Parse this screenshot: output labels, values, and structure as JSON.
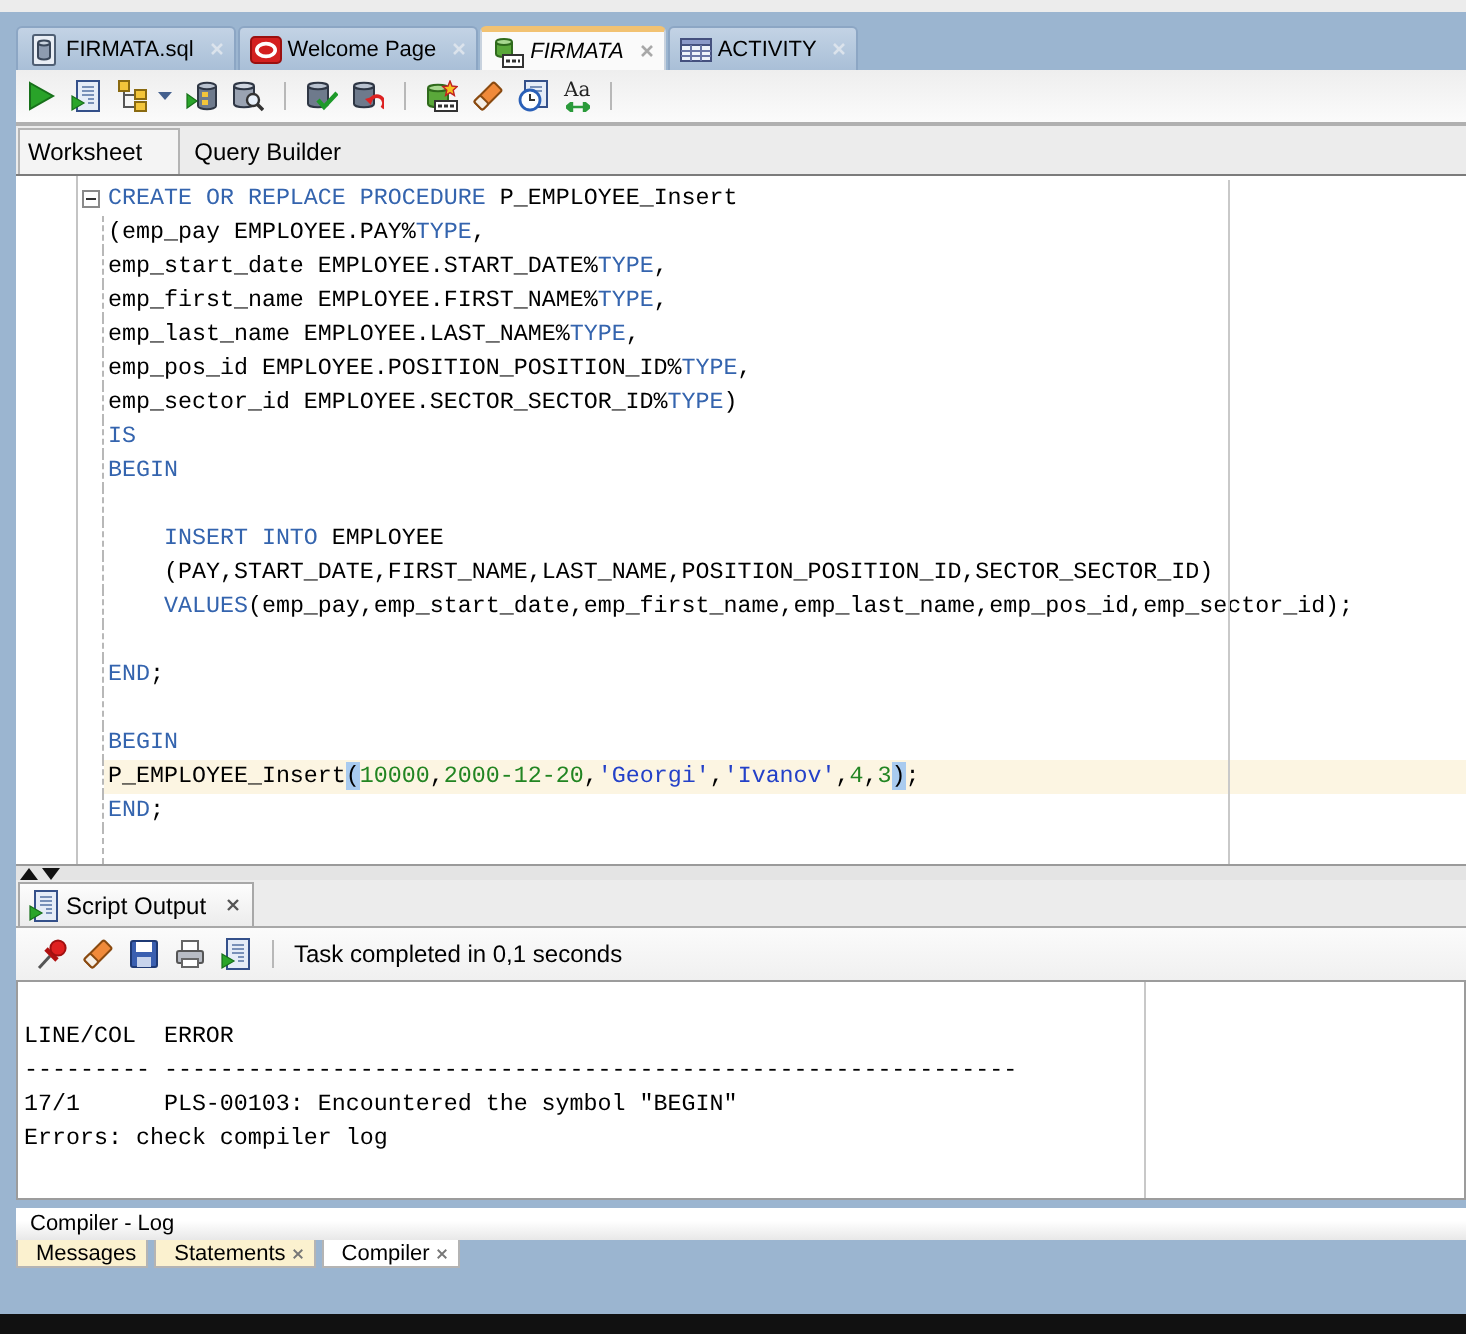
{
  "document_tabs": [
    {
      "label": "FIRMATA.sql",
      "kind": "sql-file",
      "selected": false
    },
    {
      "label": "Welcome Page",
      "kind": "start-page",
      "selected": false
    },
    {
      "label": "FIRMATA",
      "kind": "worksheet",
      "selected": true
    },
    {
      "label": "ACTIVITY",
      "kind": "table",
      "selected": false
    }
  ],
  "editor_toolbar": {
    "case_button_label": "Aa"
  },
  "editor_tabs": [
    {
      "label": "Worksheet",
      "selected": true
    },
    {
      "label": "Query Builder",
      "selected": false
    }
  ],
  "editor": {
    "lines": [
      {
        "kind": "fold-start",
        "current": false,
        "tokens": [
          {
            "kind": "keyword",
            "text": "CREATE OR REPLACE PROCEDURE"
          },
          {
            "kind": "plain",
            "text": " P_EMPLOYEE_Insert"
          }
        ]
      },
      {
        "kind": "code",
        "current": false,
        "tokens": [
          {
            "kind": "plain",
            "text": "(emp_pay EMPLOYEE.PAY%"
          },
          {
            "kind": "keyword",
            "text": "TYPE"
          },
          {
            "kind": "plain",
            "text": ","
          }
        ]
      },
      {
        "kind": "code",
        "current": false,
        "tokens": [
          {
            "kind": "plain",
            "text": "emp_start_date EMPLOYEE.START_DATE%"
          },
          {
            "kind": "keyword",
            "text": "TYPE"
          },
          {
            "kind": "plain",
            "text": ","
          }
        ]
      },
      {
        "kind": "code",
        "current": false,
        "tokens": [
          {
            "kind": "plain",
            "text": "emp_first_name EMPLOYEE.FIRST_NAME%"
          },
          {
            "kind": "keyword",
            "text": "TYPE"
          },
          {
            "kind": "plain",
            "text": ","
          }
        ]
      },
      {
        "kind": "code",
        "current": false,
        "tokens": [
          {
            "kind": "plain",
            "text": "emp_last_name EMPLOYEE.LAST_NAME%"
          },
          {
            "kind": "keyword",
            "text": "TYPE"
          },
          {
            "kind": "plain",
            "text": ","
          }
        ]
      },
      {
        "kind": "code",
        "current": false,
        "tokens": [
          {
            "kind": "plain",
            "text": "emp_pos_id EMPLOYEE.POSITION_POSITION_ID%"
          },
          {
            "kind": "keyword",
            "text": "TYPE"
          },
          {
            "kind": "plain",
            "text": ","
          }
        ]
      },
      {
        "kind": "code",
        "current": false,
        "tokens": [
          {
            "kind": "plain",
            "text": "emp_sector_id EMPLOYEE.SECTOR_SECTOR_ID%"
          },
          {
            "kind": "keyword",
            "text": "TYPE"
          },
          {
            "kind": "plain",
            "text": ")"
          }
        ]
      },
      {
        "kind": "code",
        "current": false,
        "tokens": [
          {
            "kind": "keyword",
            "text": "IS"
          }
        ]
      },
      {
        "kind": "code",
        "current": false,
        "tokens": [
          {
            "kind": "keyword",
            "text": "BEGIN"
          }
        ]
      },
      {
        "kind": "blank",
        "current": false
      },
      {
        "kind": "code",
        "current": false,
        "tokens": [
          {
            "kind": "keyword",
            "text": "    INSERT INTO"
          },
          {
            "kind": "plain",
            "text": " EMPLOYEE"
          }
        ]
      },
      {
        "kind": "code",
        "current": false,
        "tokens": [
          {
            "kind": "plain",
            "text": "    (PAY,START_DATE,FIRST_NAME,LAST_NAME,POSITION_POSITION_ID,SECTOR_SECTOR_ID)"
          }
        ]
      },
      {
        "kind": "code",
        "current": false,
        "tokens": [
          {
            "kind": "keyword",
            "text": "    VALUES"
          },
          {
            "kind": "plain",
            "text": "(emp_pay,emp_start_date,emp_first_name,emp_last_name,emp_pos_id,emp_sector_id);"
          }
        ]
      },
      {
        "kind": "blank",
        "current": false
      },
      {
        "kind": "code",
        "current": false,
        "tokens": [
          {
            "kind": "keyword",
            "text": "END"
          },
          {
            "kind": "plain",
            "text": ";"
          }
        ]
      },
      {
        "kind": "blank",
        "current": false
      },
      {
        "kind": "code",
        "current": false,
        "tokens": [
          {
            "kind": "keyword",
            "text": "BEGIN"
          }
        ]
      },
      {
        "kind": "code",
        "current": true,
        "tokens": [
          {
            "kind": "plain",
            "text": "P_EMPLOYEE_Insert"
          },
          {
            "kind": "match",
            "text": "("
          },
          {
            "kind": "number",
            "text": "10000"
          },
          {
            "kind": "plain",
            "text": ","
          },
          {
            "kind": "number",
            "text": "2000-12-20"
          },
          {
            "kind": "plain",
            "text": ","
          },
          {
            "kind": "string",
            "text": "'Georgi'"
          },
          {
            "kind": "plain",
            "text": ","
          },
          {
            "kind": "string",
            "text": "'Ivanov'"
          },
          {
            "kind": "plain",
            "text": ","
          },
          {
            "kind": "number",
            "text": "4"
          },
          {
            "kind": "plain",
            "text": ","
          },
          {
            "kind": "number",
            "text": "3"
          },
          {
            "kind": "match",
            "text": ")"
          },
          {
            "kind": "plain",
            "text": ";"
          }
        ]
      },
      {
        "kind": "code",
        "current": false,
        "tokens": [
          {
            "kind": "keyword",
            "text": "END"
          },
          {
            "kind": "plain",
            "text": ";"
          }
        ]
      }
    ]
  },
  "output": {
    "tab": {
      "label": "Script Output",
      "selected": true
    },
    "status": "Task completed in 0,1 seconds",
    "lines": [
      "LINE/COL  ERROR",
      "--------- -------------------------------------------------------------",
      "17/1      PLS-00103: Encountered the symbol \"BEGIN\"",
      "Errors: check compiler log"
    ]
  },
  "compiler_log": {
    "title": "Compiler - Log",
    "tabs": [
      {
        "label": "Messages",
        "selected": false,
        "closable": false
      },
      {
        "label": "Statements",
        "selected": false,
        "closable": true
      },
      {
        "label": "Compiler",
        "selected": true,
        "closable": true
      }
    ]
  }
}
